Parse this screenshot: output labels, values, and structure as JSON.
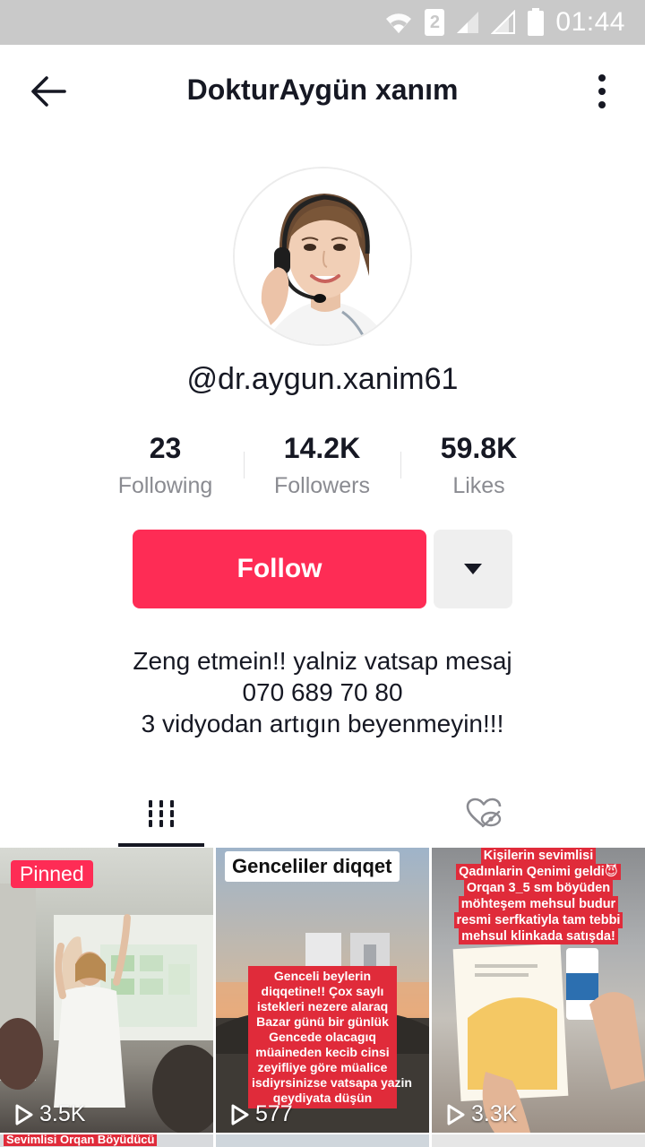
{
  "status_bar": {
    "time": "01:44",
    "sim_slot": "2",
    "icons": [
      "wifi-icon",
      "sim-2-icon",
      "signal-icon",
      "signal-icon",
      "battery-icon"
    ]
  },
  "header": {
    "title": "DokturAygün xanım",
    "back_icon": "arrow-left-icon",
    "more_icon": "vertical-dots-icon"
  },
  "profile": {
    "username": "@dr.aygun.xanim61",
    "stats": [
      {
        "value": "23",
        "label": "Following"
      },
      {
        "value": "14.2K",
        "label": "Followers"
      },
      {
        "value": "59.8K",
        "label": "Likes"
      }
    ],
    "follow_label": "Follow",
    "dropdown_icon": "caret-down-icon",
    "bio": [
      "Zeng etmein!! yalniz vatsap mesaj",
      "070 689 70 80",
      "3 vidyodan artıgın beyenmeyin!!!"
    ]
  },
  "tabs": [
    {
      "icon": "grid-videos-icon",
      "active": true
    },
    {
      "icon": "liked-hidden-icon",
      "active": false
    }
  ],
  "videos": [
    {
      "pinned_label": "Pinned",
      "views": "3.5K",
      "caption": []
    },
    {
      "title": "Genceliler diqqet",
      "views": "577",
      "caption": [
        "Genceli beylerin",
        "diqqetine!! Çox saylı",
        "istekleri nezere alaraq",
        "Bazar günü bir günlük",
        "Gencede olacagıq",
        "müaineden kecib cinsi",
        "zeyifliye göre müalice",
        "isdiyrsinizse vatsapa yazin",
        "qeydiyata düşün"
      ]
    },
    {
      "views": "3.3K",
      "caption": [
        "Kişilerin sevimlisi",
        "Qadınlarin Qenimi geldi😈",
        "Orqan 3_5 sm böyüden",
        "möhteşem mehsul budur",
        "resmi serfkatiyla tam tebbi",
        "mehsul klinkada satışda!"
      ]
    }
  ],
  "next_row": {
    "first_caption": "Sevimlisi Orqan Böyüdücü"
  }
}
